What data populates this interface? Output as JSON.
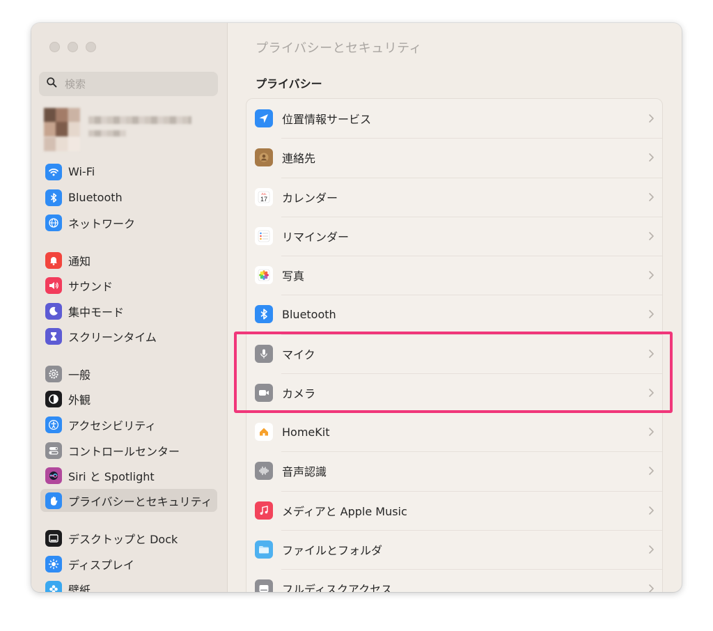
{
  "window": {
    "title": "プライバシーとセキュリティ"
  },
  "sidebar": {
    "search_placeholder": "検索",
    "items": [
      {
        "label": "Wi-Fi",
        "icon": "wifi-icon",
        "color": "#2f8cf5"
      },
      {
        "label": "Bluetooth",
        "icon": "bluetooth-icon",
        "color": "#2f8cf5"
      },
      {
        "label": "ネットワーク",
        "icon": "globe-icon",
        "color": "#2f8cf5"
      },
      {
        "label": "通知",
        "icon": "bell-icon",
        "color": "#f2453d"
      },
      {
        "label": "サウンド",
        "icon": "speaker-icon",
        "color": "#f23c5c"
      },
      {
        "label": "集中モード",
        "icon": "moon-icon",
        "color": "#5d5bd4"
      },
      {
        "label": "スクリーンタイム",
        "icon": "hourglass-icon",
        "color": "#5d5bd4"
      },
      {
        "label": "一般",
        "icon": "gear-icon",
        "color": "#8e8e93"
      },
      {
        "label": "外観",
        "icon": "appearance-icon",
        "color": "#1c1c1e"
      },
      {
        "label": "アクセシビリティ",
        "icon": "accessibility-icon",
        "color": "#2f8cf5"
      },
      {
        "label": "コントロールセンター",
        "icon": "toggles-icon",
        "color": "#8e8e93"
      },
      {
        "label": "Siri と Spotlight",
        "icon": "siri-icon",
        "color": "#b1489c"
      },
      {
        "label": "プライバシーとセキュリティ",
        "icon": "hand-icon",
        "color": "#2f8cf5",
        "selected": true
      },
      {
        "label": "デスクトップと Dock",
        "icon": "dock-icon",
        "color": "#1c1c1e"
      },
      {
        "label": "ディスプレイ",
        "icon": "sun-icon",
        "color": "#2f8cf5"
      },
      {
        "label": "壁紙",
        "icon": "flower-icon",
        "color": "#3aa8f0"
      }
    ]
  },
  "main": {
    "title": "プライバシーとセキュリティ",
    "section_title": "プライバシー",
    "rows": [
      {
        "label": "位置情報サービス",
        "icon": "location-arrow-icon",
        "color": "#2f8cf5"
      },
      {
        "label": "連絡先",
        "icon": "contacts-icon",
        "color": "#a77a47"
      },
      {
        "label": "カレンダー",
        "icon": "calendar-icon",
        "color": "#ffffff",
        "calendar_month": "JUL",
        "calendar_day": "17"
      },
      {
        "label": "リマインダー",
        "icon": "reminders-icon",
        "color": "#ffffff"
      },
      {
        "label": "写真",
        "icon": "photos-icon",
        "color": "#ffffff"
      },
      {
        "label": "Bluetooth",
        "icon": "bluetooth-icon",
        "color": "#2f8cf5"
      },
      {
        "label": "マイク",
        "icon": "microphone-icon",
        "color": "#8e8e93"
      },
      {
        "label": "カメラ",
        "icon": "camera-icon",
        "color": "#8e8e93"
      },
      {
        "label": "HomeKit",
        "icon": "home-icon",
        "color": "#ffffff"
      },
      {
        "label": "音声認識",
        "icon": "waveform-icon",
        "color": "#8e8e93"
      },
      {
        "label": "メディアと Apple Music",
        "icon": "music-icon",
        "color": "#f2445b"
      },
      {
        "label": "ファイルとフォルダ",
        "icon": "folder-icon",
        "color": "#4eb1f0"
      },
      {
        "label": "フルディスクアクセス",
        "icon": "disk-icon",
        "color": "#8e8e93"
      }
    ]
  },
  "annotation": {
    "highlight_color": "#f0377a"
  }
}
